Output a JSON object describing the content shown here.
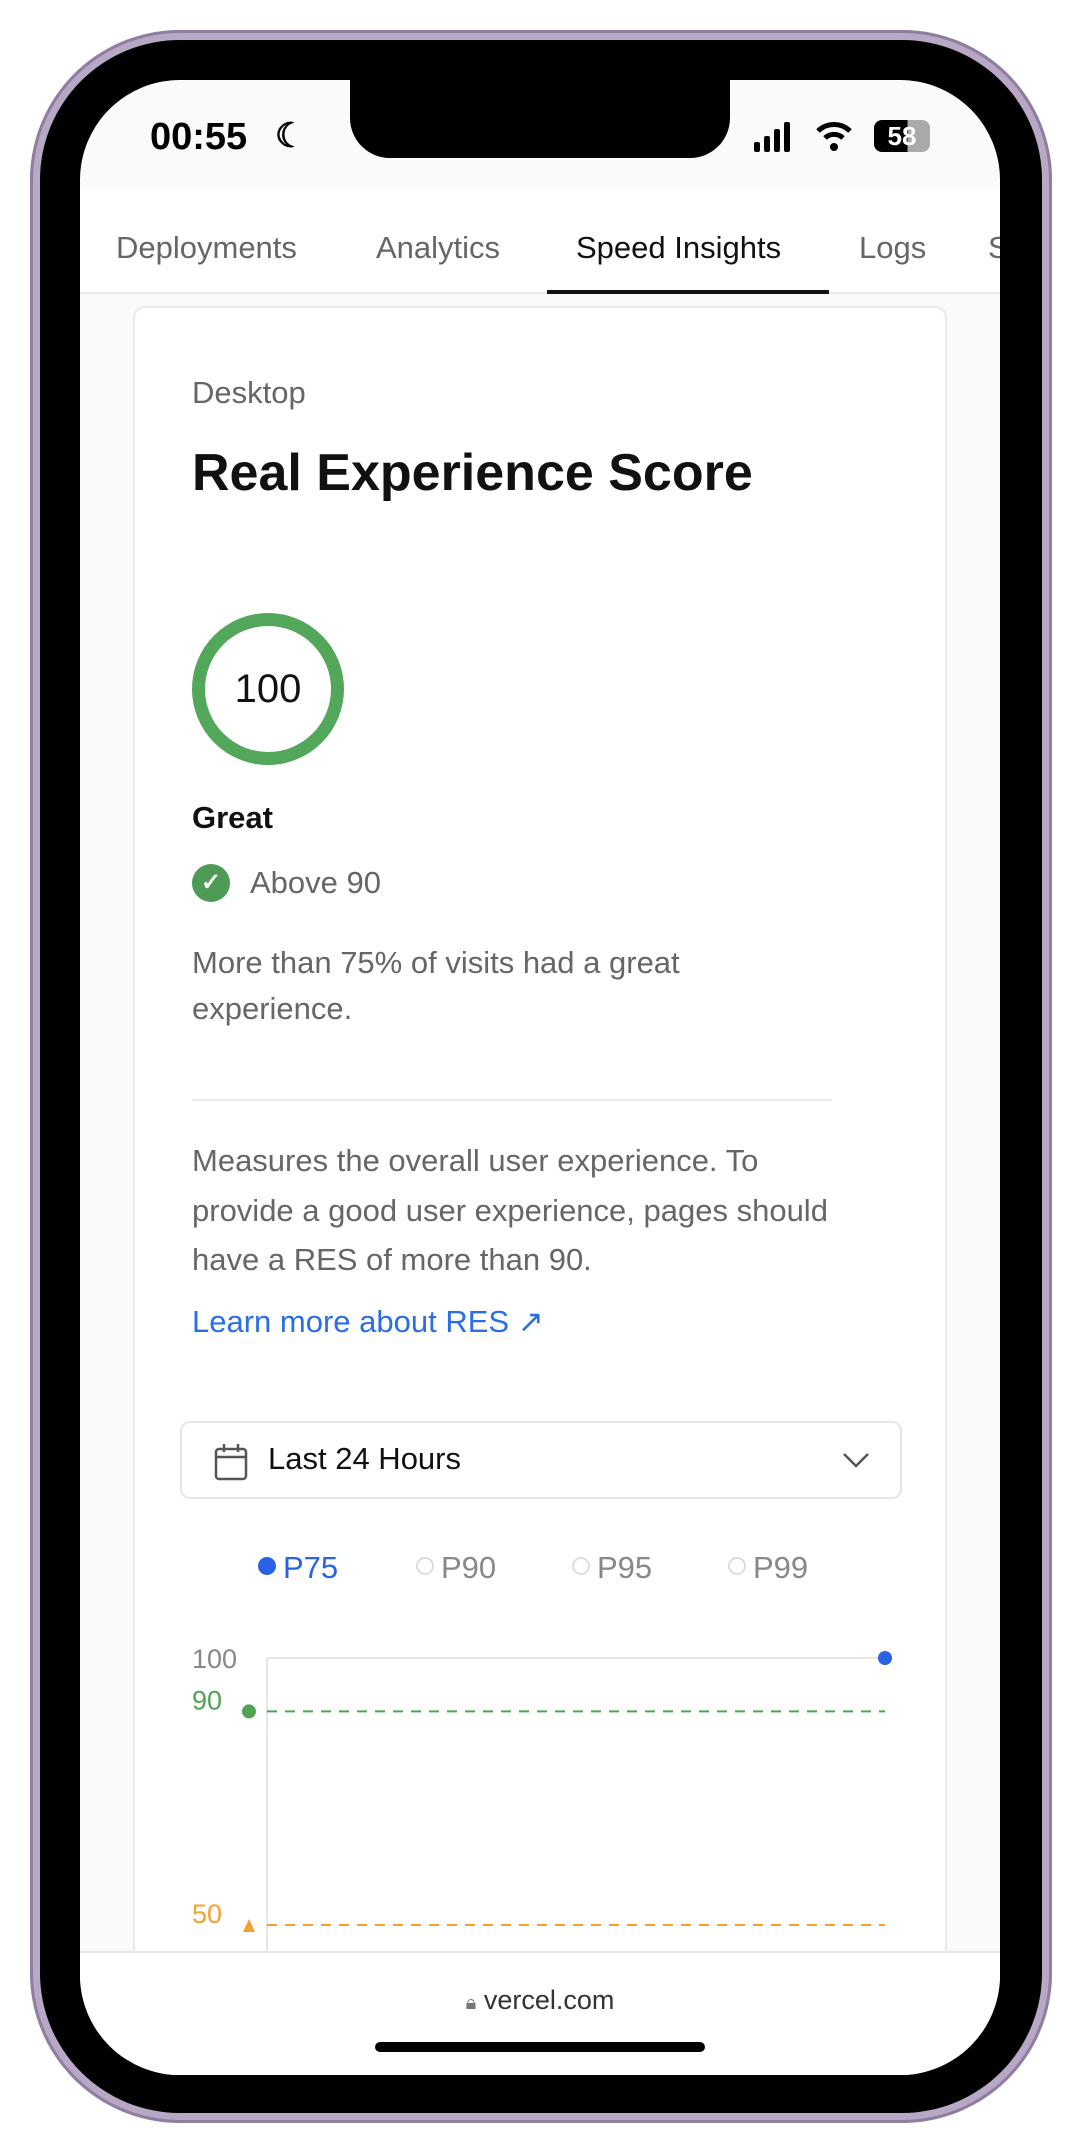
{
  "status_bar": {
    "time": "00:55",
    "battery": "58"
  },
  "tabs": [
    {
      "label": "Deployments"
    },
    {
      "label": "Analytics"
    },
    {
      "label": "Speed Insights",
      "active": true
    },
    {
      "label": "Logs"
    },
    {
      "label": "S"
    }
  ],
  "card": {
    "device": "Desktop",
    "title": "Real Experience Score",
    "score": "100",
    "score_color": "#52a75a",
    "rating": "Great",
    "threshold": "Above 90",
    "summary": "More than 75% of visits had a great experience.",
    "description": "Measures the overall user experience. To provide a good user experience, pages should have a RES of more than 90.",
    "learn_more": "Learn more about RES",
    "range_select": "Last 24 Hours"
  },
  "chart_data": {
    "type": "line",
    "legend": [
      {
        "name": "P75",
        "active": true,
        "color": "#2a62e6"
      },
      {
        "name": "P90",
        "active": false
      },
      {
        "name": "P95",
        "active": false
      },
      {
        "name": "P99",
        "active": false
      }
    ],
    "y_ticks": [
      "100",
      "90",
      "50"
    ],
    "thresholds": [
      {
        "value": 90,
        "label": "90",
        "color": "#4fa355"
      },
      {
        "value": 50,
        "label": "50",
        "color": "#f5a031"
      }
    ],
    "series": [
      {
        "name": "P75",
        "values": [
          100
        ]
      }
    ],
    "ylim_top": 100
  },
  "browser": {
    "url": "vercel.com"
  }
}
